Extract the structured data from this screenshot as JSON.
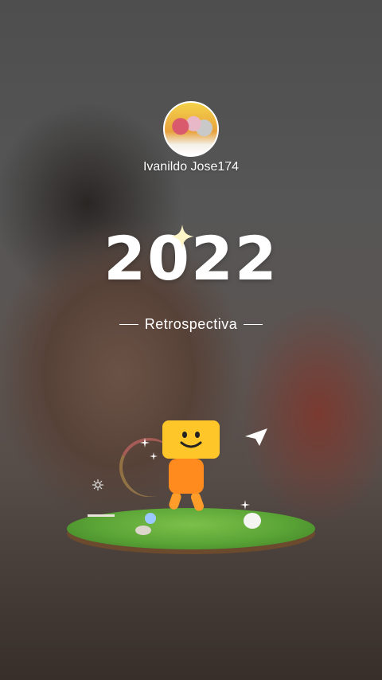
{
  "profile": {
    "username": "Ivanildo Jose174"
  },
  "recap": {
    "year": "2022",
    "title": "Retrospectiva"
  },
  "icons": {
    "avatar": "profile-photo",
    "sparkle": "sparkle-icon",
    "mascot": "smiley-box-mascot",
    "plane": "paper-plane-icon"
  },
  "colors": {
    "mascot_head": "#ffc62a",
    "mascot_body": "#ff8a1e",
    "grass": "#5aa436"
  }
}
